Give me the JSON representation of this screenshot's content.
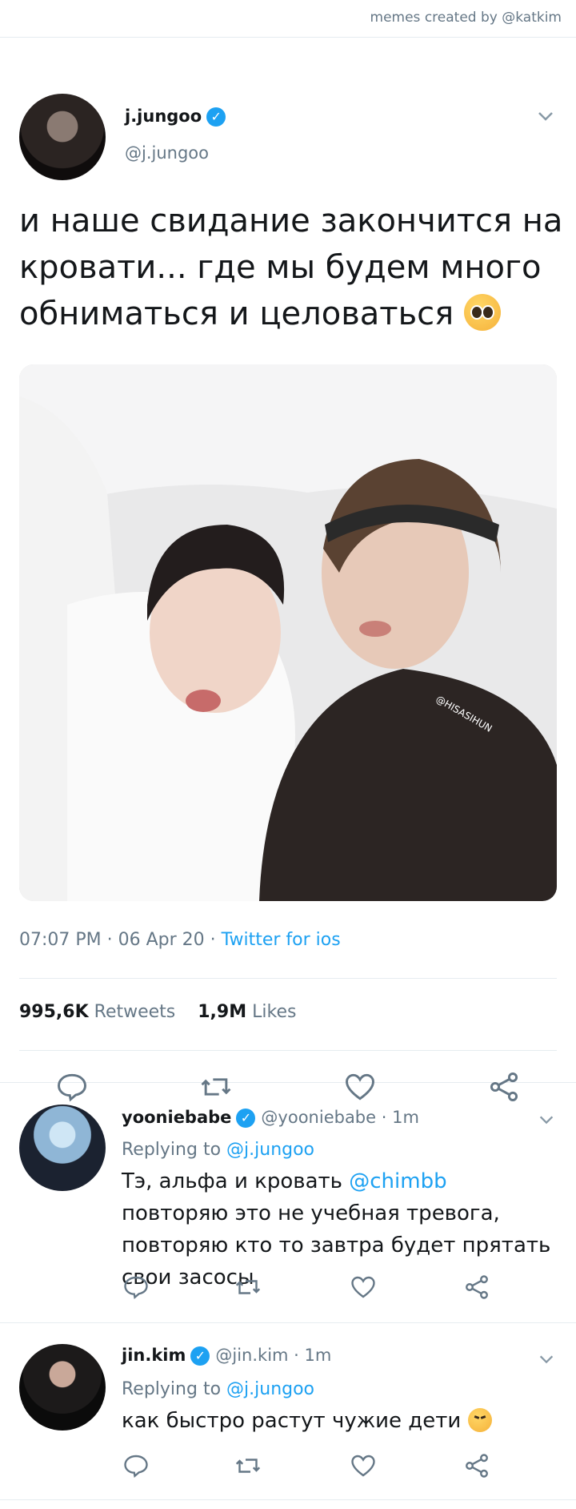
{
  "credit": "memes created by @katkim",
  "tweet": {
    "name": "j.jungoo",
    "handle": "@j.jungoo",
    "text": "и наше свидание закончится на кровати... где мы будем много обниматься и целоваться",
    "time": "07:07 PM",
    "date": "06 Apr 20",
    "source": "Twitter for ios",
    "retweets_count": "995,6K",
    "retweets_label": "Retweets",
    "likes_count": "1,9M",
    "likes_label": "Likes",
    "photo_watermark": "@HISASIHUN"
  },
  "replies": [
    {
      "name": "yooniebabe",
      "handle": "@yooniebabe",
      "time": "1m",
      "replying_label": "Replying to",
      "replying_to": "@j.jungoo",
      "text_before": "Тэ, альфа и кровать ",
      "mention": "@chimbb",
      "text_after": " повторяю это не учебная тревога, повторяю кто то завтра будет прятать свои засосы"
    },
    {
      "name": "jin.kim",
      "handle": "@jin.kim",
      "time": "1m",
      "replying_label": "Replying to",
      "replying_to": "@j.jungoo",
      "text": "как быстро растут чужие дети"
    }
  ],
  "icons": [
    "comment-icon",
    "retweet-icon",
    "like-icon",
    "share-icon",
    "chevron-down-icon",
    "verified-icon"
  ],
  "colors": {
    "accent": "#1da1f2",
    "muted": "#657786",
    "text": "#14171a"
  }
}
